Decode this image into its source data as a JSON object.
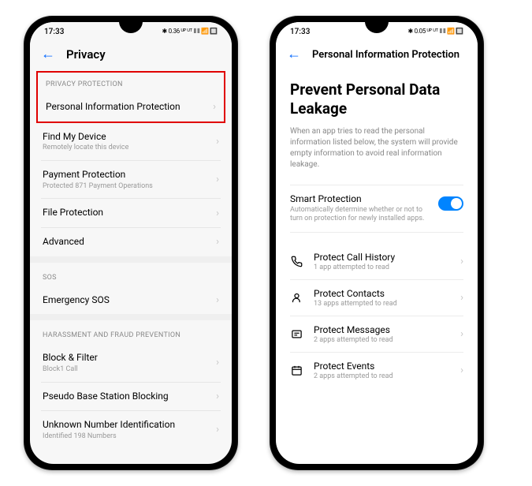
{
  "phone1": {
    "status": {
      "time": "17:33",
      "right": "✱ 0.36 ᵁᴾ ᵁᵀ ⫴ ⫴ 📶 🔲"
    },
    "header": {
      "title": "Privacy"
    },
    "sections": {
      "privacy_protection": {
        "header": "PRIVACY PROTECTION",
        "items": [
          {
            "title": "Personal Information Protection",
            "sub": ""
          },
          {
            "title": "Find My Device",
            "sub": "Remotely locate this device"
          },
          {
            "title": "Payment Protection",
            "sub": "Protected 871 Payment Operations"
          },
          {
            "title": "File Protection",
            "sub": ""
          },
          {
            "title": "Advanced",
            "sub": ""
          }
        ]
      },
      "sos": {
        "header": "SOS",
        "items": [
          {
            "title": "Emergency SOS",
            "sub": ""
          }
        ]
      },
      "harassment": {
        "header": "HARASSMENT AND FRAUD PREVENTION",
        "items": [
          {
            "title": "Block & Filter",
            "sub": "Block1 Call"
          },
          {
            "title": "Pseudo Base Station Blocking",
            "sub": ""
          },
          {
            "title": "Unknown Number Identification",
            "sub": "Identified 198 Numbers"
          }
        ]
      }
    }
  },
  "phone2": {
    "status": {
      "time": "17:33",
      "right": "✱ 0.05 ᵁᴾ ᵁᵀ ⫴ ⫴ 📶 🔲"
    },
    "header": {
      "title": "Personal Information Protection"
    },
    "big_title": "Prevent Personal Data Leakage",
    "description": "When an app tries to read the personal information listed below, the system will provide empty information to avoid real information leakage.",
    "smart": {
      "title": "Smart Protection",
      "sub": "Automatically determine whether or not to turn on protection for newly installed apps."
    },
    "items": [
      {
        "title": "Protect Call History",
        "sub": "1 app attempted to read"
      },
      {
        "title": "Protect Contacts",
        "sub": "13 apps attempted to read"
      },
      {
        "title": "Protect Messages",
        "sub": "2 apps attempted to read"
      },
      {
        "title": "Protect Events",
        "sub": "2 apps attempted to read"
      }
    ]
  }
}
